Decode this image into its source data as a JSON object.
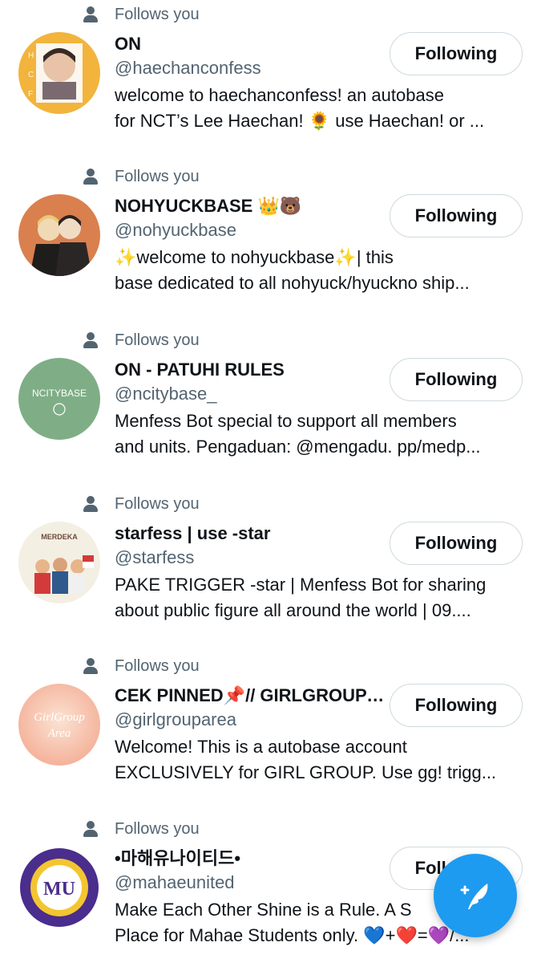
{
  "follows_label": "Follows you",
  "accounts": [
    {
      "name": "ON",
      "handle": "@haechanconfess",
      "bio_line1": "welcome to haechanconfess! an autobase",
      "bio_line2": "for NCT’s Lee Haechan! 🌻 use Haechan! or ...",
      "button": "Following",
      "avatar_color": "#f2b43c"
    },
    {
      "name": "NOHYUCKBASE 👑🐻",
      "handle": "@nohyuckbase",
      "bio_line1": "✨welcome to nohyuckbase✨| this",
      "bio_line2": "base dedicated to all nohyuck/hyuckno ship...",
      "button": "Following",
      "avatar_color": "#d9804e"
    },
    {
      "name": "ON - PATUHI RULES",
      "handle": "@ncitybase_",
      "bio_line1": "Menfess Bot special to support all members",
      "bio_line2": "and units. Pengaduan: @mengadu. pp/medp...",
      "button": "Following",
      "avatar_color": "#7fae86",
      "avatar_text": "NCITYBASE"
    },
    {
      "name": "starfess | use -star",
      "handle": "@starfess",
      "bio_line1": "PAKE TRIGGER -star | Menfess Bot for sharing",
      "bio_line2": "about public figure all around the world | 09....",
      "button": "Following",
      "avatar_color": "#f4efe3",
      "avatar_text": "MERDEKA"
    },
    {
      "name": "CEK PINNED📌// GIRLGROUP AREA",
      "handle": "@girlgrouparea",
      "bio_line1": "Welcome! This is a autobase account",
      "bio_line2": "EXCLUSIVELY for GIRL GROUP. Use gg! trigg...",
      "button": "Following",
      "avatar_color": "#f4b9a3",
      "avatar_text": "GirlGroup Area"
    },
    {
      "name": "•마해유나이티드•",
      "handle": "@mahaeunited",
      "bio_line1": "Make Each Other Shine is a Rule. A S",
      "bio_line2": "Place for Mahae Students only. 💙+❤️=💜/...",
      "button": "Following",
      "avatar_color": "#4a2d8c",
      "avatar_text": "MU"
    }
  ],
  "fab": {
    "icon": "compose-icon",
    "color": "#1d9bf0"
  }
}
